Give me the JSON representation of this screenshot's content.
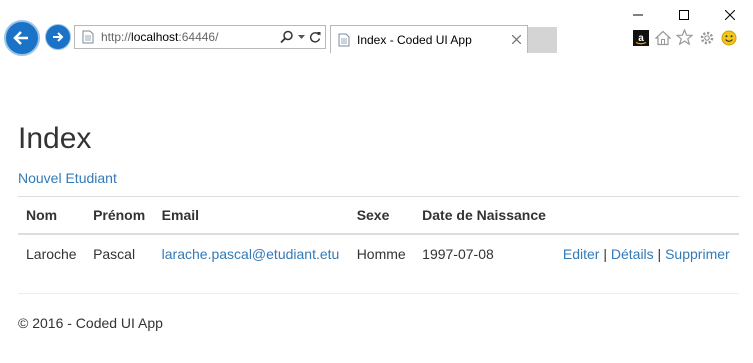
{
  "browser": {
    "url_prefix": "http://",
    "url_host": "localhost",
    "url_rest": ":64446/",
    "tab_title": "Index - Coded UI App",
    "icons": {
      "back": "back-arrow-icon",
      "forward": "forward-arrow-icon",
      "search": "search-icon",
      "refresh": "refresh-icon",
      "close_tab": "close-icon",
      "home": "home-icon",
      "favorites": "star-icon",
      "settings": "gear-icon",
      "feedback": "smiley-icon",
      "amazon": "amazon-icon"
    }
  },
  "page": {
    "title": "Index",
    "create_link": "Nouvel Etudiant"
  },
  "table": {
    "headers": [
      "Nom",
      "Prénom",
      "Email",
      "Sexe",
      "Date de Naissance",
      ""
    ],
    "rows": [
      {
        "nom": "Laroche",
        "prenom": "Pascal",
        "email": "larache.pascal@etudiant.etu",
        "sexe": "Homme",
        "date": "1997-07-08",
        "actions": {
          "edit": "Editer",
          "sep1": " | ",
          "details": "Détails",
          "sep2": " | ",
          "delete": "Supprimer"
        }
      }
    ]
  },
  "footer": {
    "text": "© 2016 - Coded UI App"
  },
  "colors": {
    "link": "#337ab7",
    "nav_button": "#1a73c7"
  }
}
